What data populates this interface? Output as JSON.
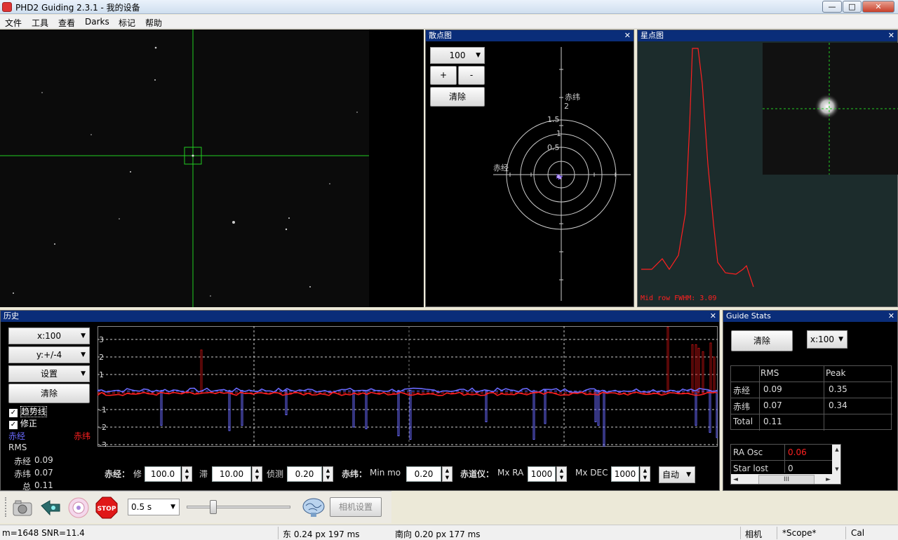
{
  "window": {
    "title": "PHD2 Guiding 2.3.1 - 我的设备",
    "min": "—",
    "max": "□",
    "close": "✕"
  },
  "menu": [
    "文件",
    "工具",
    "查看",
    "Darks",
    "标记",
    "帮助"
  ],
  "scatter_panel": {
    "title": "散点图",
    "close": "✕",
    "scale": "100",
    "plus": "+",
    "minus": "-",
    "clear": "清除",
    "axis_dec": "赤纬",
    "axis_ra": "赤经",
    "ring_labels": [
      "2",
      "1.5",
      "1",
      "0.5"
    ]
  },
  "profile_panel": {
    "title": "星点图",
    "close": "✕",
    "fwhm_label": "Mid row FWHM: 3.09"
  },
  "history_panel": {
    "title": "历史",
    "close": "✕",
    "x_scale": "x:100",
    "y_scale": "y:+/-4",
    "settings": "设置",
    "clear": "清除",
    "trend_label": "趋势线",
    "correction_label": "修正",
    "legend_ra": "赤经",
    "legend_dec": "赤纬",
    "rms_label": "RMS",
    "rms_ra_label": "赤经",
    "rms_ra": "0.09",
    "rms_dec_label": "赤纬",
    "rms_dec": "0.07",
    "rms_total_label": "总",
    "rms_total": "0.11",
    "y_ticks": [
      "3",
      "2",
      "1",
      "-1",
      "-2",
      "-3"
    ]
  },
  "controls": {
    "ra_label": "赤经：",
    "ra_agg_label": "修",
    "ra_agg": "100.0",
    "ra_hyst_label": "滞",
    "ra_hyst": "10.00",
    "ra_min_label": "侦测",
    "ra_min": "0.20",
    "dec_label": "赤纬：",
    "dec_min_label": "Min mo",
    "dec_min": "0.20",
    "mount_label": "赤道仪：",
    "max_ra_label": "Mx RA",
    "max_ra": "1000",
    "max_dec_label": "Mx DEC",
    "max_dec": "1000",
    "dec_mode": "自动"
  },
  "stats_panel": {
    "title": "Guide Stats",
    "close": "✕",
    "clear": "清除",
    "scale": "x:100",
    "headers": [
      "",
      "RMS",
      "Peak"
    ],
    "rows": [
      [
        "赤经",
        "0.09",
        "0.35"
      ],
      [
        "赤纬",
        "0.07",
        "0.34"
      ],
      [
        "Total",
        "0.11",
        ""
      ]
    ],
    "osc_label": "RA Osc",
    "osc_value": "0.06",
    "star_lost_label": "Star lost",
    "star_lost_value": "0",
    "hscroll": "III"
  },
  "toolbar": {
    "exposure": "0.5 s",
    "camera_settings": "相机设置",
    "stop": "STOP"
  },
  "status": {
    "star": "m=1648 SNR=11.4",
    "east": "东  0.24 px 197 ms",
    "south": "南向 0.20 px 177 ms",
    "camera": "相机",
    "scope": "*Scope*",
    "cal": "Cal"
  },
  "colors": {
    "ra": "#6a6aff",
    "dec": "#ff2020",
    "crosshair": "#22cc22",
    "panel_title": "#0a2d79"
  },
  "chart_data": {
    "type": "line",
    "x_scale": 100,
    "ylim": [
      -4,
      4
    ],
    "y_ticks": [
      3,
      2,
      1,
      -1,
      -2,
      -3
    ],
    "series": [
      {
        "name": "赤经",
        "approx_level": 0.1
      },
      {
        "name": "赤纬",
        "approx_level": -0.1
      }
    ]
  }
}
